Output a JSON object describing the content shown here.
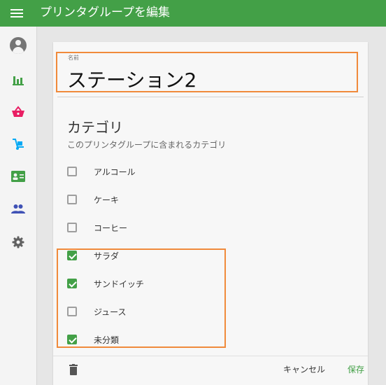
{
  "header": {
    "title": "プリンタグループを編集"
  },
  "sidebar": {
    "items": [
      {
        "icon": "account-circle-icon",
        "color": "#757575"
      },
      {
        "icon": "bar-chart-icon",
        "color": "#43a047"
      },
      {
        "icon": "basket-icon",
        "color": "#e91e63"
      },
      {
        "icon": "hand-truck-icon",
        "color": "#03a9f4"
      },
      {
        "icon": "contact-card-icon",
        "color": "#43a047"
      },
      {
        "icon": "people-icon",
        "color": "#3f51b5"
      },
      {
        "icon": "gear-icon",
        "color": "#616161"
      }
    ]
  },
  "form": {
    "name_label": "名前",
    "name_value": "ステーション2",
    "category_title": "カテゴリ",
    "category_subtitle": "このプリンタグループに含まれるカテゴリ",
    "categories": [
      {
        "label": "アルコール",
        "checked": false
      },
      {
        "label": "ケーキ",
        "checked": false
      },
      {
        "label": "コーヒー",
        "checked": false
      },
      {
        "label": "サラダ",
        "checked": true
      },
      {
        "label": "サンドイッチ",
        "checked": true
      },
      {
        "label": "ジュース",
        "checked": false
      },
      {
        "label": "未分類",
        "checked": true
      }
    ]
  },
  "footer": {
    "cancel_label": "キャンセル",
    "save_label": "保存"
  },
  "colors": {
    "primary": "#43a047",
    "highlight": "#f08a3b"
  }
}
